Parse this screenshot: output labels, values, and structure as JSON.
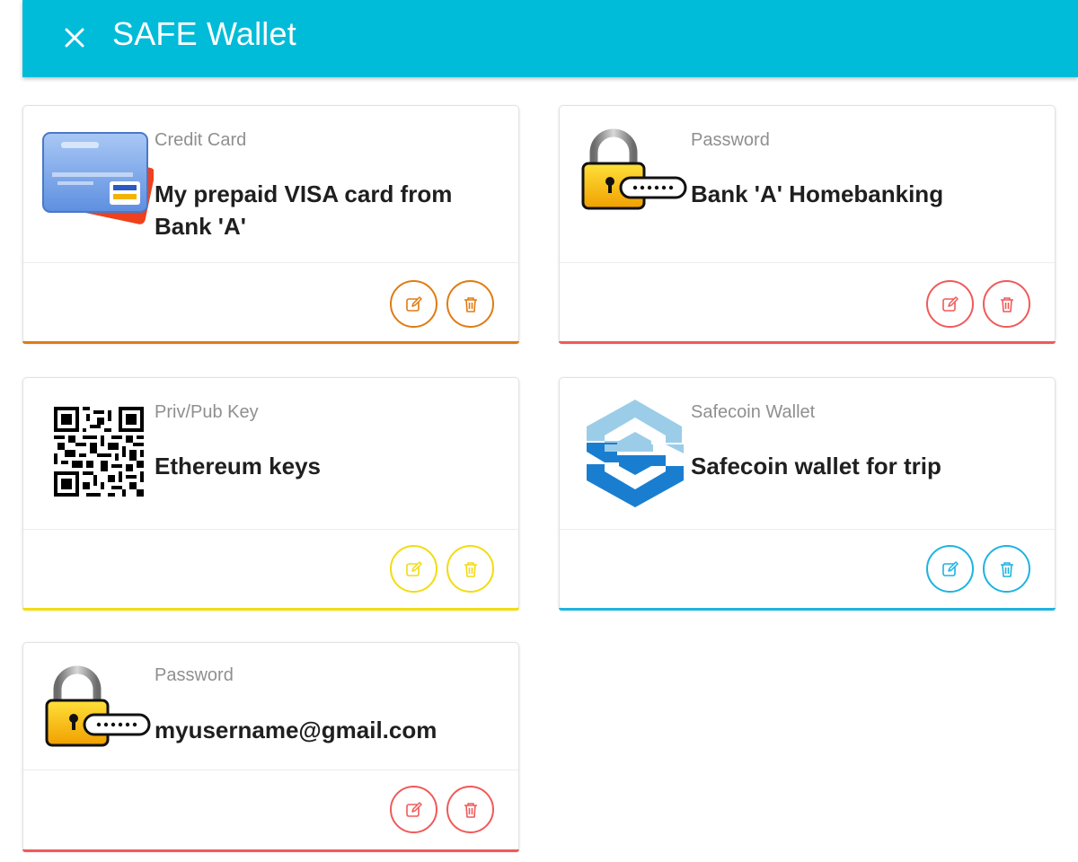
{
  "app": {
    "title": "SAFE Wallet",
    "close_icon": "close-icon",
    "header_color": "#00bcd8"
  },
  "cards": [
    {
      "type": "Credit Card",
      "name": "My prepaid VISA card from Bank 'A'",
      "icon": "credit-card-icon",
      "accent": "#e07b12"
    },
    {
      "type": "Password",
      "name": "Bank 'A' Homebanking",
      "icon": "padlock-password-icon",
      "accent": "#f05a5a"
    },
    {
      "type": "Priv/Pub Key",
      "name": "Ethereum keys",
      "icon": "qr-code-icon",
      "accent": "#f2dc12"
    },
    {
      "type": "Safecoin Wallet",
      "name": "Safecoin wallet for trip",
      "icon": "safecoin-logo-icon",
      "accent": "#1eb4e0"
    },
    {
      "type": "Password",
      "name": "myusername@gmail.com",
      "icon": "padlock-password-icon",
      "accent": "#f05a5a"
    }
  ],
  "actions": {
    "edit_icon": "edit-icon",
    "delete_icon": "trash-icon"
  }
}
